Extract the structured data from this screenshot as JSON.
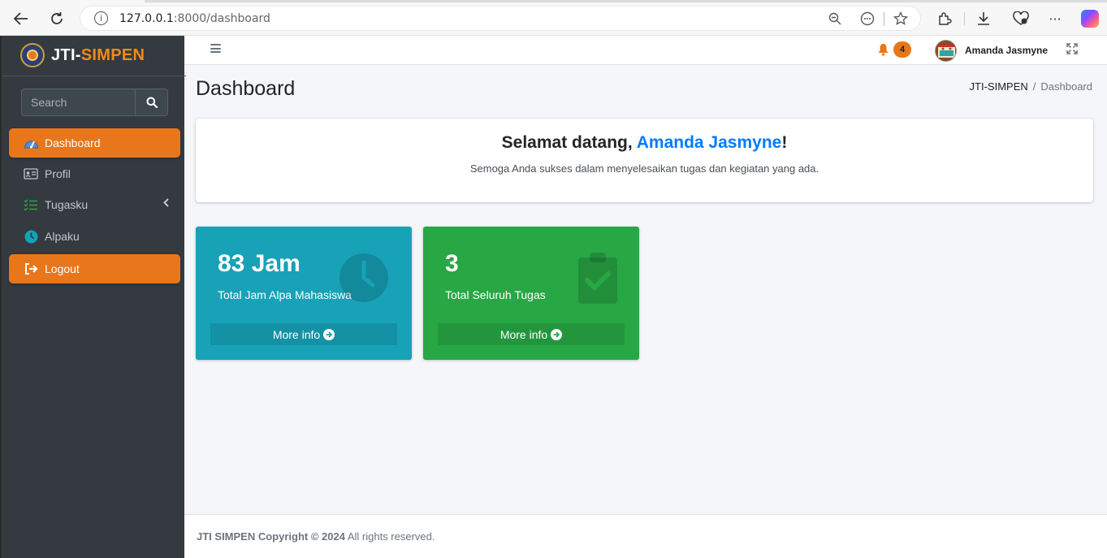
{
  "browser": {
    "url_host": "127.0.0.1",
    "url_path": ":8000/dashboard"
  },
  "sidebar": {
    "brand_prefix": "JTI-",
    "brand_accent": "SIMPEN",
    "search_placeholder": "Search",
    "items": [
      {
        "label": "Dashboard",
        "icon": "tachometer-icon",
        "active": true
      },
      {
        "label": "Profil",
        "icon": "id-card-icon",
        "active": false
      },
      {
        "label": "Tugasku",
        "icon": "tasks-icon",
        "active": false
      },
      {
        "label": "Alpaku",
        "icon": "clock-icon",
        "active": false
      },
      {
        "label": "Logout",
        "icon": "sign-out-icon",
        "active": true
      }
    ]
  },
  "topnav": {
    "notification_count": "4",
    "user_name": "Amanda Jasmyne"
  },
  "header": {
    "title": "Dashboard",
    "breadcrumb_root": "JTI-SIMPEN",
    "breadcrumb_separator": "/",
    "breadcrumb_current": "Dashboard"
  },
  "welcome": {
    "greeting": "Selamat datang, ",
    "name": "Amanda Jasmyne",
    "exclaim": "!",
    "subtitle": "Semoga Anda sukses dalam menyelesaikan tugas dan kegiatan yang ada."
  },
  "stats": [
    {
      "value": "83 Jam",
      "label": "Total Jam Alpa Mahasiswa",
      "more": "More info",
      "color": "#17a2b8"
    },
    {
      "value": "3",
      "label": "Total Seluruh Tugas",
      "more": "More info",
      "color": "#28a745"
    }
  ],
  "footer": {
    "bold": "JTI SIMPEN Copyright © 2024",
    "rest": " All rights reserved."
  },
  "colors": {
    "accent": "#e8761a",
    "sidebar_bg": "#343a40",
    "link": "#007bff"
  }
}
